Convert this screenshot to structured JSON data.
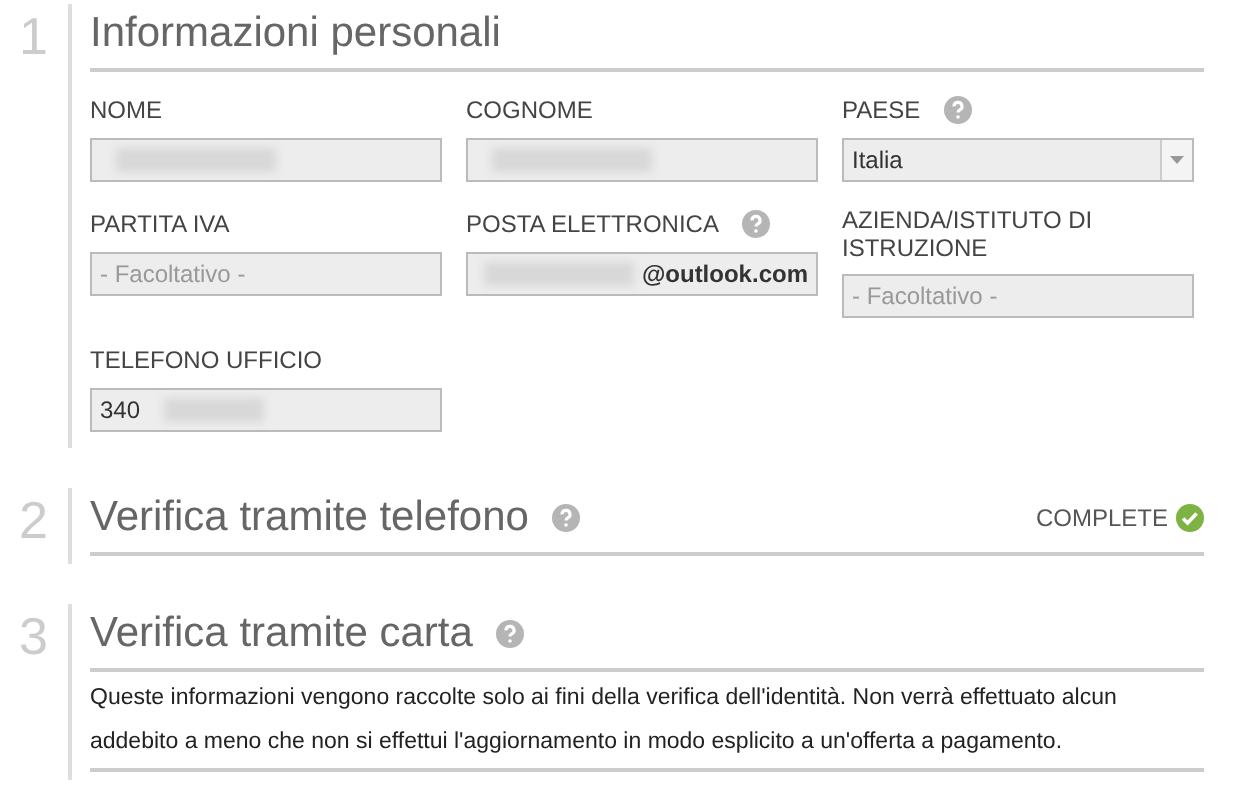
{
  "sections": [
    {
      "number": "1",
      "title": "Informazioni personali",
      "kind": "form",
      "fields": [
        {
          "label": "NOME",
          "help": false,
          "kind": "text",
          "redacted": true
        },
        {
          "label": "COGNOME",
          "help": false,
          "kind": "text",
          "redacted": true
        },
        {
          "label": "PAESE",
          "help": true,
          "kind": "select",
          "value": "Italia",
          "redacted": false
        },
        {
          "label": "PARTITA IVA",
          "help": false,
          "kind": "text",
          "placeholder": "- Facoltativo -",
          "redacted": false
        },
        {
          "label": "POSTA ELETTRONICA",
          "help": true,
          "kind": "text",
          "value": "@outlook.com",
          "redacted": true
        },
        {
          "label": "AZIENDA/ISTITUTO DI ISTRUZIONE",
          "help": false,
          "kind": "text",
          "placeholder": "- Facoltativo -",
          "redacted": false
        },
        {
          "label": "TELEFONO UFFICIO",
          "help": false,
          "kind": "text",
          "value": "340",
          "redacted": true
        }
      ]
    },
    {
      "number": "2",
      "title": "Verifica tramite telefono",
      "kind": "status",
      "help": true,
      "status": "COMPLETE",
      "complete": true
    },
    {
      "number": "3",
      "title": "Verifica tramite carta",
      "kind": "text",
      "help": true,
      "text": "Queste informazioni vengono raccolte solo ai fini della verifica dell'identità. Non verrà effettuato alcun addebito a meno che non si effettui l'aggiornamento in modo esplicito a un'offerta a pagamento."
    }
  ]
}
